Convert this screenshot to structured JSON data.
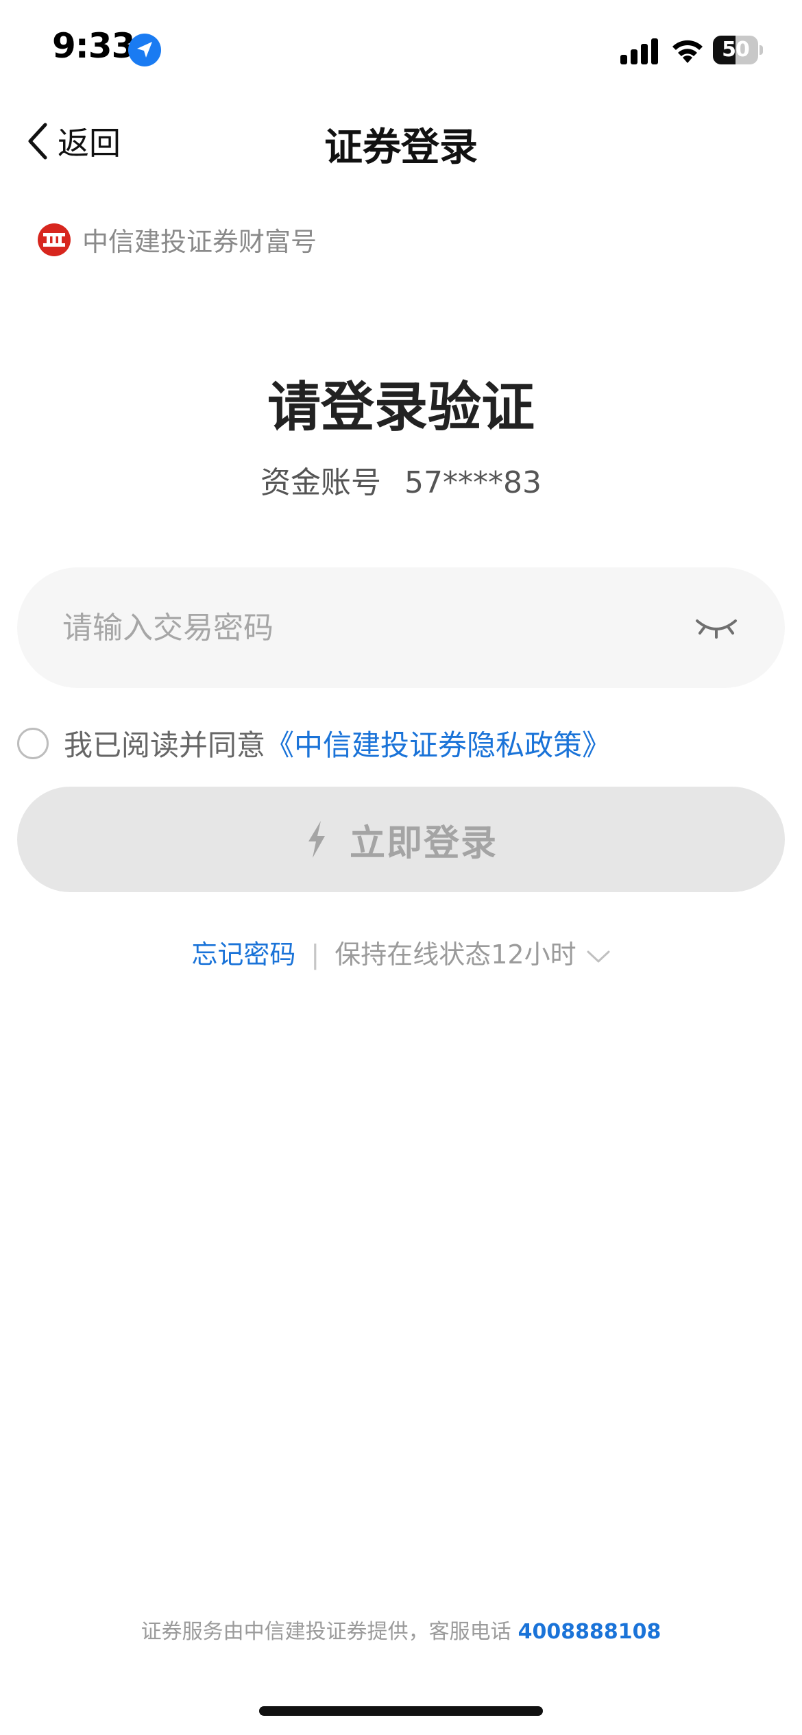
{
  "status_bar": {
    "time": "9:33",
    "battery_level": "50",
    "battery_fraction": 0.5,
    "icons": [
      "location-arrow-icon",
      "cellular-signal-icon",
      "wifi-icon",
      "battery-icon"
    ]
  },
  "nav": {
    "back_label": "返回",
    "title": "证券登录"
  },
  "brand": {
    "logo_icon": "citic-logo",
    "name": "中信建投证券财富号"
  },
  "main": {
    "heading": "请登录验证",
    "account_label": "资金账号",
    "account_value": "57****83"
  },
  "password": {
    "placeholder": "请输入交易密码",
    "value": "",
    "toggle_icon": "eye-closed-icon"
  },
  "agreement": {
    "checked": false,
    "text": "我已阅读并同意",
    "link": "《中信建投证券隐私政策》"
  },
  "login_button": {
    "label": "立即登录",
    "icon": "lightning-icon",
    "enabled": false
  },
  "options": {
    "forgot": "忘记密码",
    "separator": "|",
    "keep_online": "保持在线状态12小时"
  },
  "footer": {
    "text": "证券服务由中信建投证券提供，客服电话",
    "phone": "4008888108"
  },
  "colors": {
    "link_blue": "#1a73d8",
    "logo_red": "#d7261e",
    "button_disabled_bg": "#e6e6e6"
  }
}
